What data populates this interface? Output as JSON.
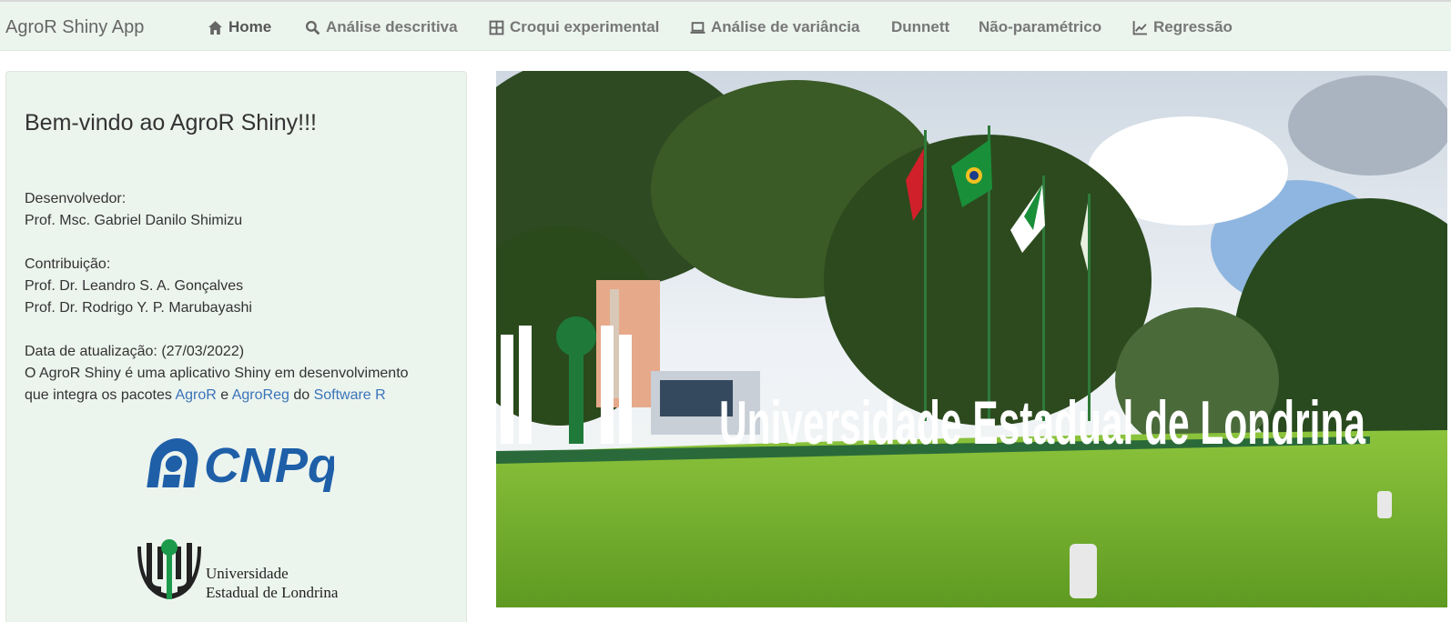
{
  "navbar": {
    "brand": "AgroR Shiny App",
    "items": [
      {
        "label": "Home",
        "icon": "home-icon"
      },
      {
        "label": "Análise descritiva",
        "icon": "search-icon"
      },
      {
        "label": "Croqui experimental",
        "icon": "grid-icon"
      },
      {
        "label": "Análise de variância",
        "icon": "laptop-icon"
      },
      {
        "label": "Dunnett",
        "icon": ""
      },
      {
        "label": "Não-paramétrico",
        "icon": ""
      },
      {
        "label": "Regressão",
        "icon": "line-chart-icon"
      }
    ]
  },
  "sidebar": {
    "welcome": "Bem-vindo ao AgroR Shiny!!!",
    "developer_heading": "Desenvolvedor:",
    "developer_name": "Prof. Msc. Gabriel Danilo Shimizu",
    "contribution_heading": "Contribuição:",
    "contributors": [
      "Prof. Dr. Leandro S. A. Gonçalves",
      "Prof. Dr. Rodrigo Y. P. Marubayashi"
    ],
    "update": "Data de atualização: (27/03/2022)",
    "description_line1": "O AgroR Shiny é uma aplicativo Shiny em desenvolvimento",
    "description_prefix": "que integra os pacotes ",
    "link_agror": "AgroR",
    "conj": " e ",
    "link_agroreg": "AgroReg",
    "do_text": " do ",
    "link_software": "Software R"
  },
  "logos": {
    "cnpq_text": "CNPq",
    "uel_line1": "Universidade",
    "uel_line2": "Estadual de Londrina"
  },
  "photo": {
    "sign_text": "Universidade Estadual de Londrina"
  },
  "colors": {
    "navbar_bg": "#ecf4ee",
    "link": "#3a74b8",
    "cnpq_blue": "#1e5fa8",
    "uel_green": "#1a9a4a",
    "grass": "#6aa82a"
  }
}
